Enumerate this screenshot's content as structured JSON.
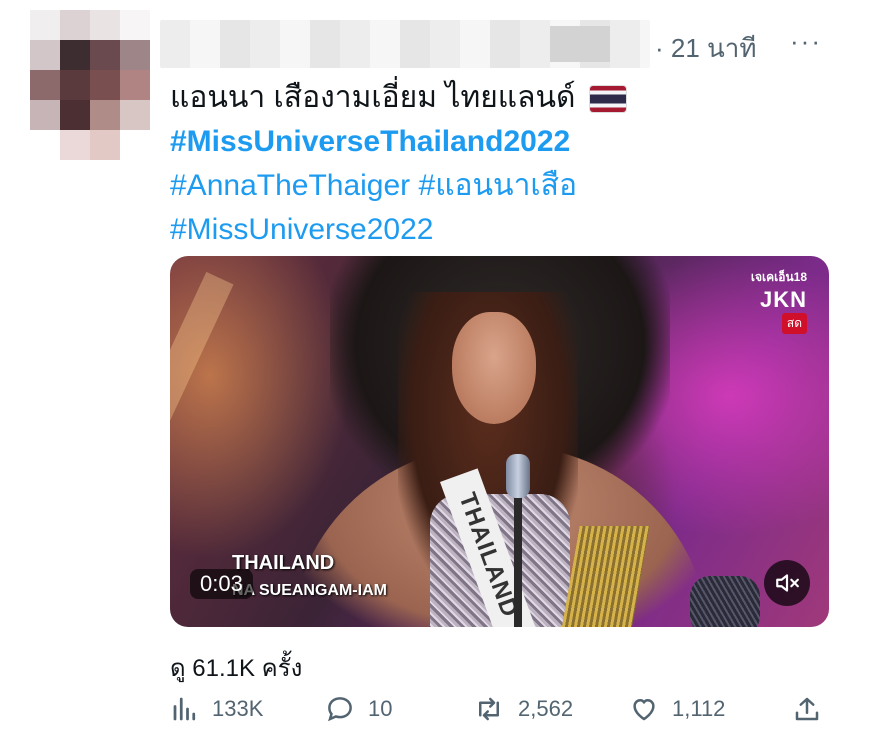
{
  "header": {
    "time": "· 21 นาที",
    "more": "···"
  },
  "tweet": {
    "line1": "แอนนา เสืองามเอี่ยม ไทยแลนด์",
    "hashtag_bold": "#MissUniverseThailand2022",
    "hashtag2": "#AnnaTheThaiger",
    "hashtag3": "#แอนนาเสือ",
    "hashtag4": "#MissUniverse2022",
    "flag_icon": "thailand-flag"
  },
  "video": {
    "channel": "เจเคเอ็น18",
    "logo": "JKN",
    "live_badge": "สด",
    "caption_country": "THAILAND",
    "caption_name": "NA SUEANGAM-IAM",
    "sash_text": "THAILAND",
    "duration": "0:03"
  },
  "views": "ดู 61.1K ครั้ง",
  "actions": {
    "views_count": "133K",
    "reply_count": "10",
    "retweet_count": "2,562",
    "like_count": "1,112"
  },
  "colors": {
    "link": "#1d9bf0",
    "muted": "#536471",
    "text": "#0f1419"
  }
}
